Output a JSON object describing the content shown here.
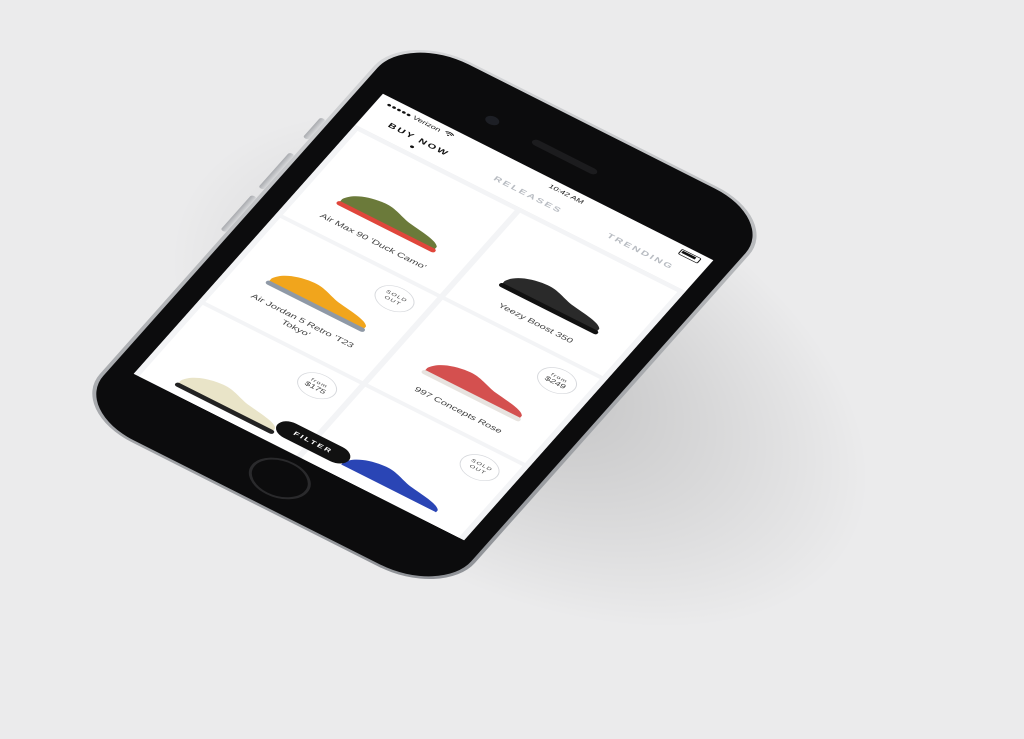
{
  "statusbar": {
    "carrier": "●●●●● Verizon",
    "time": "10:42 AM"
  },
  "tabs": [
    {
      "label": "BUY NOW"
    },
    {
      "label": "RELEASES"
    },
    {
      "label": "TRENDING"
    }
  ],
  "products": [
    {
      "name": "Air Max 90 'Duck Camo'",
      "badge_top": "",
      "badge_bottom": "",
      "shoe_color": "#6b7a3a",
      "accent": "#e0463b"
    },
    {
      "name": "Yeezy Boost 350",
      "badge_top": "",
      "badge_bottom": "",
      "shoe_color": "#2a2a2a",
      "accent": "#111111"
    },
    {
      "name": "Air Jordan 5 Retro 'T23 Tokyo'",
      "badge_top": "SOLD",
      "badge_bottom": "OUT",
      "shoe_color": "#f1a51c",
      "accent": "#8f99a6"
    },
    {
      "name": "997 Concepts Rose",
      "badge_top": "from",
      "badge_bottom": "$249",
      "shoe_color": "#d4504f",
      "accent": "#e7e3df"
    },
    {
      "name": "",
      "badge_top": "from",
      "badge_bottom": "$175",
      "shoe_color": "#e9e4c8",
      "accent": "#222222"
    },
    {
      "name": "",
      "badge_top": "SOLD",
      "badge_bottom": "OUT",
      "shoe_color": "#2a45b5",
      "accent": "#ffffff"
    }
  ],
  "filter": {
    "label": "FILTER"
  },
  "colors": {
    "background": "#ebebec",
    "phone_face": "#0c0c0d",
    "screen": "#ffffff",
    "accent": "#111111"
  }
}
